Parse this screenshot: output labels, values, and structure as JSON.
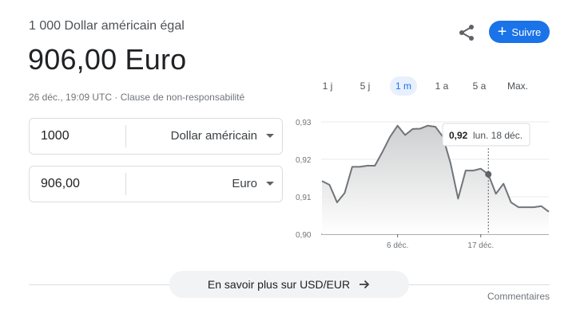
{
  "header": {
    "subtitle": "1 000 Dollar américain égal",
    "value": "906,00 Euro",
    "timestamp": "26 déc., 19:09 UTC",
    "separator": "·",
    "disclaimer": "Clause de non-responsabilité",
    "follow_label": "Suivre",
    "share_icon": "share-icon"
  },
  "converter": {
    "from": {
      "amount": "1000",
      "currency": "Dollar américain"
    },
    "to": {
      "amount": "906,00",
      "currency": "Euro"
    }
  },
  "ranges": [
    {
      "label": "1 j",
      "active": false
    },
    {
      "label": "5 j",
      "active": false
    },
    {
      "label": "1 m",
      "active": true
    },
    {
      "label": "1 a",
      "active": false
    },
    {
      "label": "5 a",
      "active": false
    },
    {
      "label": "Max.",
      "active": false
    }
  ],
  "chart_data": {
    "type": "area",
    "ylim": [
      0.9,
      0.93
    ],
    "yticks": [
      "0,93",
      "0,92",
      "0,91",
      "0,90"
    ],
    "yvals": [
      0.93,
      0.92,
      0.91,
      0.9
    ],
    "xtick_labels": [
      {
        "label": "6 déc.",
        "index": 10
      },
      {
        "label": "17 déc.",
        "index": 21
      }
    ],
    "values": [
      0.9142,
      0.9132,
      0.9085,
      0.911,
      0.918,
      0.918,
      0.9183,
      0.9183,
      0.922,
      0.926,
      0.929,
      0.9265,
      0.9281,
      0.9282,
      0.929,
      0.9287,
      0.926,
      0.919,
      0.9095,
      0.917,
      0.917,
      0.9175,
      0.916,
      0.9108,
      0.9135,
      0.9085,
      0.9072,
      0.9072,
      0.9072,
      0.9075,
      0.906
    ],
    "line_color": "#70757a",
    "tooltip": {
      "value": "0,92",
      "date": "lun. 18 déc.",
      "index": 22
    }
  },
  "footer": {
    "learn_more": "En savoir plus sur USD/EUR",
    "feedback": "Commentaires"
  }
}
